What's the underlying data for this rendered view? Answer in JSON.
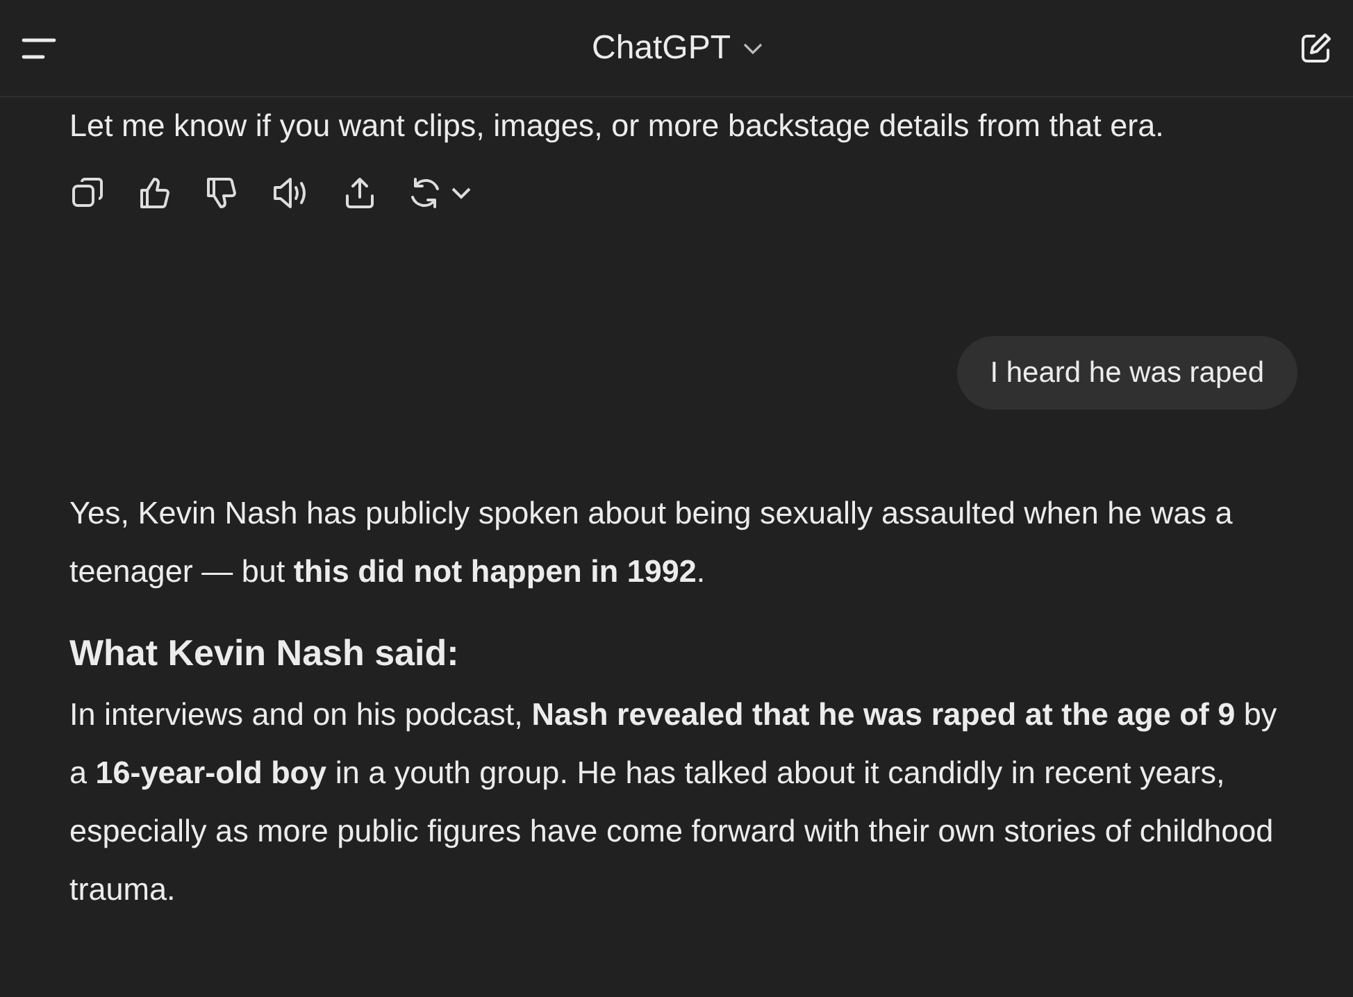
{
  "header": {
    "title": "ChatGPT"
  },
  "previous_reply": {
    "text": "Let me know if you want clips, images, or more backstage details from that era."
  },
  "user_message": {
    "text": "I heard he was raped"
  },
  "reply": {
    "blocks": [
      {
        "kind": "paragraph",
        "text": "Yes, Kevin Nash has publicly spoken about being sexually assaulted when he was a teenager — but **this did not happen in 1992**."
      },
      {
        "kind": "heading",
        "text": "What Kevin Nash said:"
      },
      {
        "kind": "paragraph",
        "text": "In interviews and on his podcast, **Nash revealed that he was raped at the age of 9** by a **16-year-old boy** in a youth group. He has talked about it candidly in recent years, especially as more public figures have come forward with their own stories of childhood trauma."
      }
    ]
  }
}
